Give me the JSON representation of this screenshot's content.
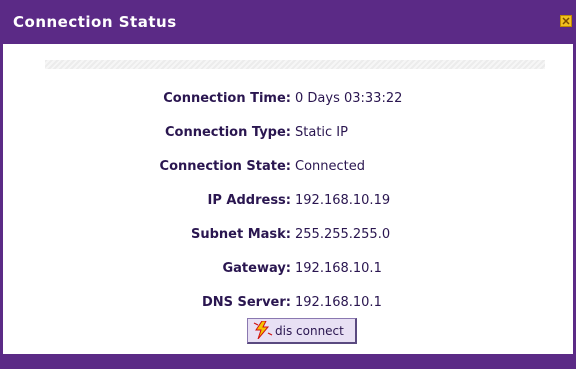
{
  "window": {
    "title": "Connection Status"
  },
  "status": {
    "rows": [
      {
        "label": "Connection Time:",
        "value": "0 Days 03:33:22"
      },
      {
        "label": "Connection Type:",
        "value": "Static IP"
      },
      {
        "label": "Connection State:",
        "value": "Connected"
      },
      {
        "label": "IP Address:",
        "value": "192.168.10.19"
      },
      {
        "label": "Subnet Mask:",
        "value": "255.255.255.0"
      },
      {
        "label": "Gateway:",
        "value": "192.168.10.1"
      },
      {
        "label": "DNS Server:",
        "value": "192.168.10.1"
      }
    ]
  },
  "actions": {
    "disconnect_label": "dis connect"
  },
  "icons": {
    "close": "close-icon",
    "disconnect": "lightning-bolt-icon"
  },
  "colors": {
    "frame": "#5b2a86",
    "text": "#2a1650",
    "close_button": "#f0c020"
  }
}
